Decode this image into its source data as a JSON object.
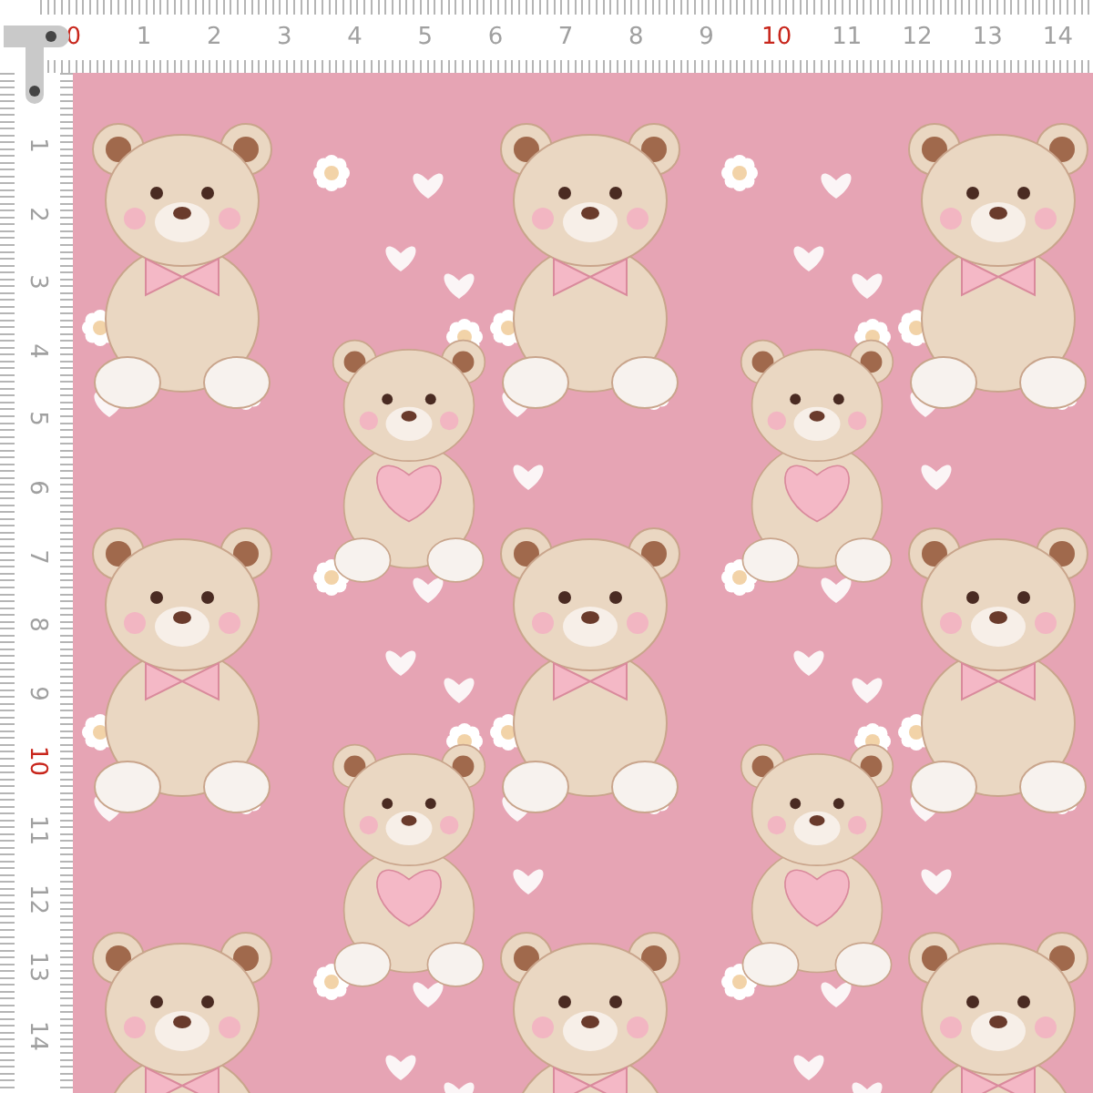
{
  "ruler_top": {
    "labels": [
      {
        "text": "0",
        "color": "#c8261c"
      },
      {
        "text": "1",
        "color": "#a0a0a0"
      },
      {
        "text": "2",
        "color": "#a0a0a0"
      },
      {
        "text": "3",
        "color": "#a0a0a0"
      },
      {
        "text": "4",
        "color": "#a0a0a0"
      },
      {
        "text": "5",
        "color": "#a0a0a0"
      },
      {
        "text": "6",
        "color": "#a0a0a0"
      },
      {
        "text": "7",
        "color": "#a0a0a0"
      },
      {
        "text": "8",
        "color": "#a0a0a0"
      },
      {
        "text": "9",
        "color": "#a0a0a0"
      },
      {
        "text": "10",
        "color": "#c8261c"
      },
      {
        "text": "11",
        "color": "#a0a0a0"
      },
      {
        "text": "12",
        "color": "#a0a0a0"
      },
      {
        "text": "13",
        "color": "#a0a0a0"
      },
      {
        "text": "14",
        "color": "#a0a0a0"
      }
    ]
  },
  "ruler_left": {
    "labels": [
      {
        "text": "1",
        "color": "#a0a0a0"
      },
      {
        "text": "2",
        "color": "#a0a0a0"
      },
      {
        "text": "3",
        "color": "#a0a0a0"
      },
      {
        "text": "4",
        "color": "#a0a0a0"
      },
      {
        "text": "5",
        "color": "#a0a0a0"
      },
      {
        "text": "6",
        "color": "#a0a0a0"
      },
      {
        "text": "7",
        "color": "#a0a0a0"
      },
      {
        "text": "8",
        "color": "#a0a0a0"
      },
      {
        "text": "9",
        "color": "#a0a0a0"
      },
      {
        "text": "10",
        "color": "#c8261c"
      },
      {
        "text": "11",
        "color": "#a0a0a0"
      },
      {
        "text": "12",
        "color": "#a0a0a0"
      },
      {
        "text": "13",
        "color": "#a0a0a0"
      },
      {
        "text": "14",
        "color": "#a0a0a0"
      }
    ]
  }
}
